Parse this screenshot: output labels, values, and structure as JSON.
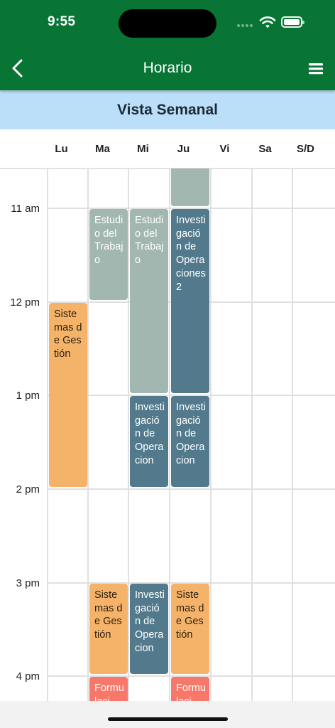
{
  "status_bar": {
    "time": "9:55"
  },
  "app_bar": {
    "title": "Horario",
    "back_icon": "chevron-left-icon",
    "menu_icon": "menu-icon"
  },
  "view": {
    "title": "Vista Semanal"
  },
  "days": [
    "Lu",
    "Ma",
    "Mi",
    "Ju",
    "Vi",
    "Sa",
    "S/D"
  ],
  "time_labels": [
    "11 am",
    "12 pm",
    "1 pm",
    "2 pm",
    "3 pm",
    "4 pm"
  ],
  "colors": {
    "header_green": "#087535",
    "banner_blue": "#bcdff9",
    "sage": "#a1b7b0",
    "steel": "#527a8c",
    "orange": "#f5b36a",
    "coral": "#f6786a"
  },
  "events": [
    {
      "day": "Ju",
      "title": "",
      "color": "sage"
    },
    {
      "day": "Ma",
      "title": "Estudio del Trabajo",
      "color": "sage"
    },
    {
      "day": "Mi",
      "title": "Estudio del Trabajo",
      "color": "sage"
    },
    {
      "day": "Ju",
      "title": "Investigación de Operaciones 2",
      "color": "steel"
    },
    {
      "day": "Lu",
      "title": "Sistemas de Gestión",
      "color": "orange"
    },
    {
      "day": "Mi",
      "title": "Investigación de Operacion",
      "color": "steel"
    },
    {
      "day": "Ju",
      "title": "Investigación de Operacion",
      "color": "steel"
    },
    {
      "day": "Ma",
      "title": "Sistemas de Gestión",
      "color": "orange"
    },
    {
      "day": "Mi",
      "title": "Investigación de Operacion",
      "color": "steel"
    },
    {
      "day": "Ju",
      "title": "Sistemas de Gestión",
      "color": "orange"
    },
    {
      "day": "Ma",
      "title": "Formulaci",
      "color": "coral"
    },
    {
      "day": "Ju",
      "title": "Formulaci",
      "color": "coral"
    }
  ]
}
